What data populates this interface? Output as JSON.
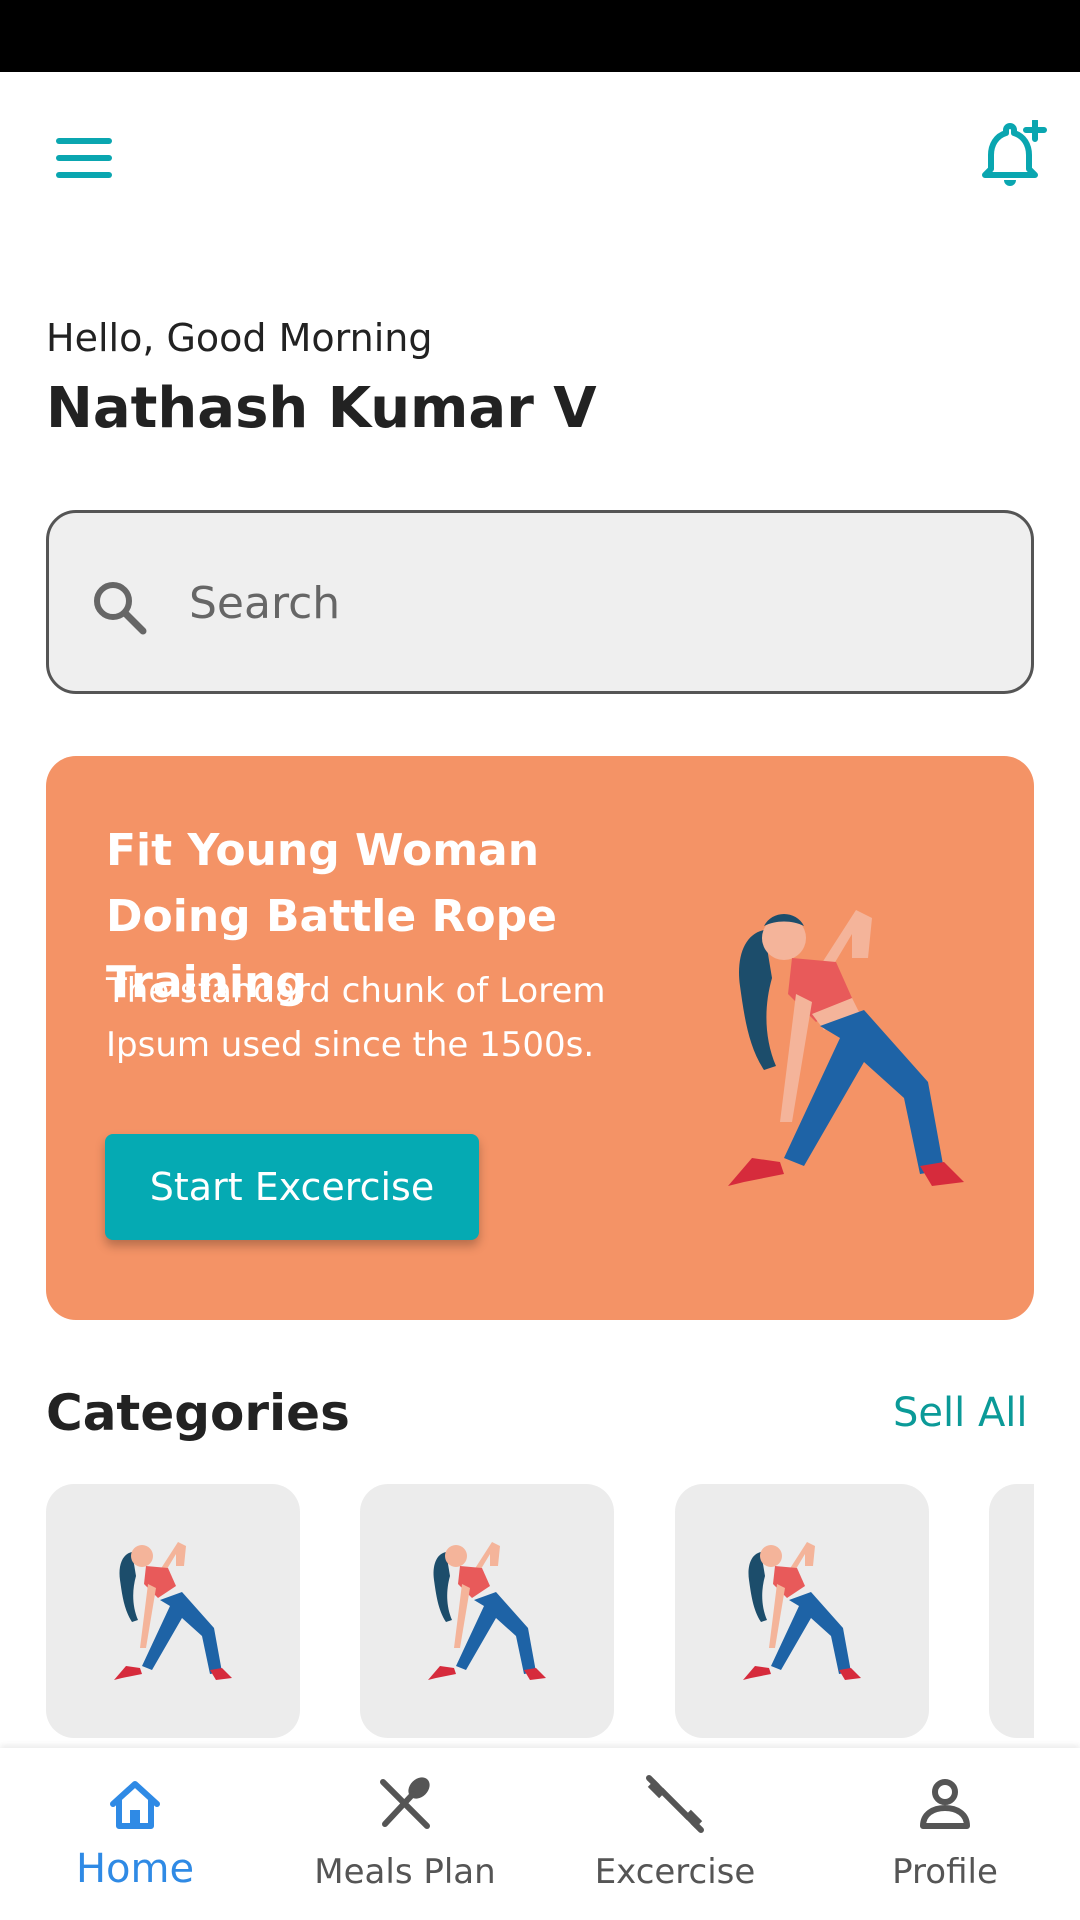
{
  "greeting": "Hello, Good Morning",
  "user_name": "Nathash Kumar V",
  "search": {
    "placeholder": "Search"
  },
  "promo": {
    "title": "Fit Young Woman Doing Battle Rope Training",
    "description": "The standard chunk of Lorem Ipsum used since the 1500s.",
    "button_label": "Start Excercise"
  },
  "categories": {
    "title": "Categories",
    "see_all_label": "Sell All"
  },
  "bottom_nav": {
    "items": [
      {
        "label": "Home",
        "icon": "home-icon",
        "active": true
      },
      {
        "label": "Meals Plan",
        "icon": "fork-spoon-icon",
        "active": false
      },
      {
        "label": "Excercise",
        "icon": "dumbbell-icon",
        "active": false
      },
      {
        "label": "Profile",
        "icon": "person-icon",
        "active": false
      }
    ]
  },
  "colors": {
    "accent": "#0aa6b0",
    "promo_bg": "#f49366",
    "nav_active": "#2f8ae5"
  }
}
